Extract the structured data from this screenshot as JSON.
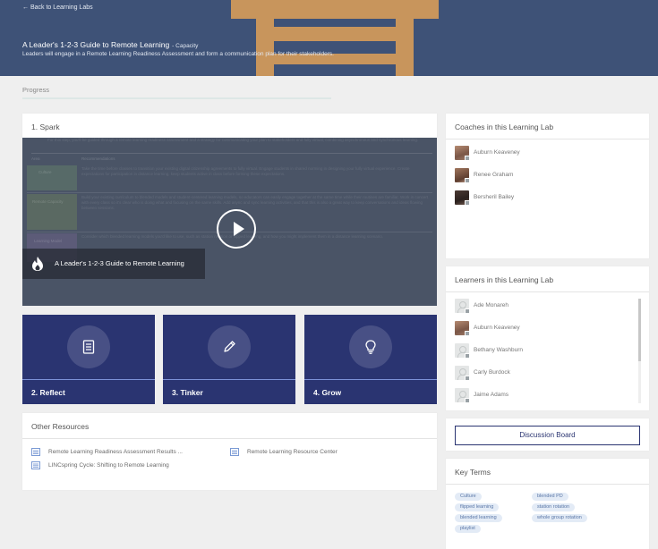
{
  "colors": {
    "banner_bg": "#3e5277",
    "banner_art": "#c8955c",
    "tile_bg": "#2a3471",
    "tile_accent": "#7d92d8",
    "link_blue": "#5a77a7",
    "tag_bg": "#e3ebf6"
  },
  "header": {
    "back_link": "← Back to Learning Labs",
    "title": "A Leader's 1-2-3 Guide to Remote Learning",
    "category": "- Capacity",
    "description": "Leaders will engage in a Remote Learning Readiness Assessment and form a communication plan for their stakeholders."
  },
  "progress": {
    "label": "Progress",
    "fraction": 0.0
  },
  "spark": {
    "title": "1. Spark",
    "video_caption": "A Leader's 1-2-3 Guide to Remote Learning",
    "icon": "flame-icon",
    "doc_background": {
      "intro": "For this step, you'll be guided through a remote learning readiness assessment and a strategy for communicating your plan to stakeholders and fully virtual, combining asynchronous and synchronous learning.",
      "col_area": "Area",
      "col_recs": "Recommendations",
      "rows": [
        {
          "area": "Culture",
          "text": "Take the time before classes to transition your existing digital citizenship agreements to fully virtual. Engage students in shared norming in designing your fully virtual experience. Create expectations for participation in distance learning, keep students active in class before forming these expectations."
        },
        {
          "area": "Remote Capacity",
          "text": "Build your existing curriculum to blended models and student-centered learning models, so educators can easily engage together at the same time while their routines are familiar. Work in concert with every class so it's clear who is doing what and focusing on the same skills. Add async and sync learning activities, and that this is also a great way to keep conversations and ideas flowing between sessions."
        },
        {
          "area": "Learning Model",
          "text": "Consider which blended learning models you'd like to use, such as station rotation or flipped learning, and how you might implement them in a distance learning scenario."
        }
      ]
    }
  },
  "steps": [
    {
      "label": "2. Reflect",
      "icon": "document-icon"
    },
    {
      "label": "3. Tinker",
      "icon": "pencil-icon"
    },
    {
      "label": "4. Grow",
      "icon": "lightbulb-icon"
    }
  ],
  "resources": {
    "title": "Other Resources",
    "items": [
      {
        "label": "Remote Learning Readiness Assessment Results ...",
        "icon": "list-document-icon"
      },
      {
        "label": "Remote Learning Resource Center",
        "icon": "list-document-icon"
      },
      {
        "label": "LINCspring Cycle: Shifting to Remote Learning",
        "icon": "list-document-icon"
      }
    ]
  },
  "coaches": {
    "title": "Coaches in this Learning Lab",
    "people": [
      {
        "name": "Auburn Keaveney",
        "avatar": "photo"
      },
      {
        "name": "Renee Graham",
        "avatar": "photo"
      },
      {
        "name": "Bersheril Bailey",
        "avatar": "photo"
      }
    ]
  },
  "learners": {
    "title": "Learners in this Learning Lab",
    "people": [
      {
        "name": "Ade Monareh",
        "avatar": "placeholder"
      },
      {
        "name": "Auburn Keaveney",
        "avatar": "photo"
      },
      {
        "name": "Bethany Washburn",
        "avatar": "placeholder"
      },
      {
        "name": "Carly Burdock",
        "avatar": "placeholder"
      },
      {
        "name": "Jaime Adams",
        "avatar": "placeholder"
      }
    ]
  },
  "discussion_board": {
    "label": "Discussion Board"
  },
  "key_terms": {
    "title": "Key Terms",
    "terms": [
      "Culture",
      "blended PD",
      "flipped learning",
      "station rotation",
      "blended learning",
      "whole group rotation",
      "playlist"
    ]
  }
}
